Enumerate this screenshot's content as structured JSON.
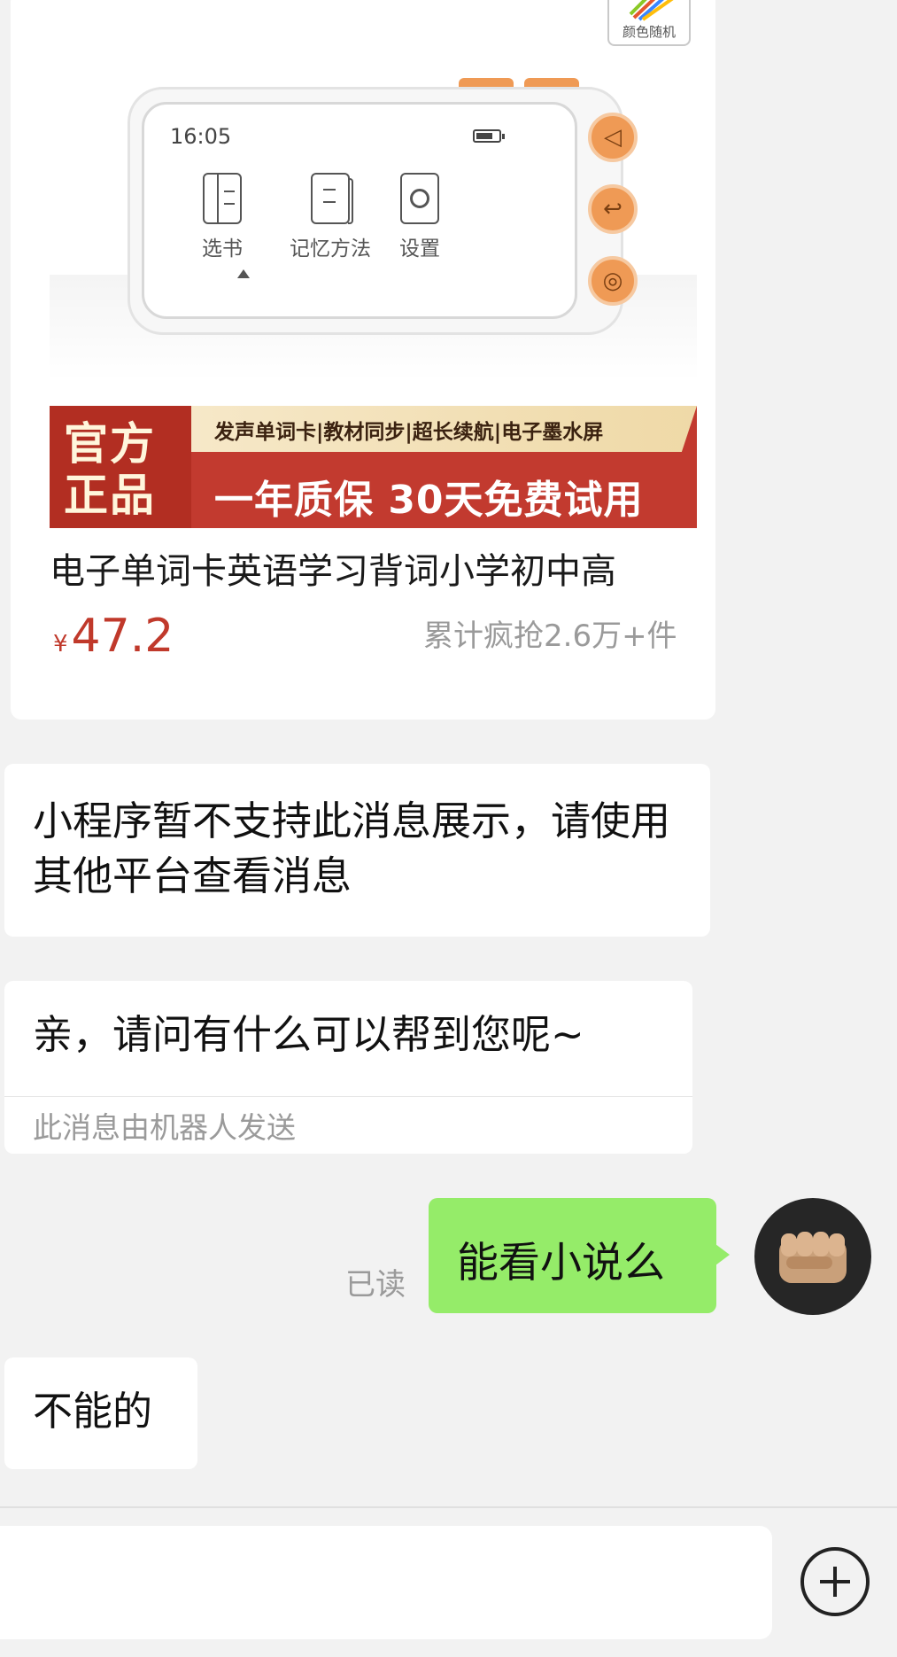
{
  "product": {
    "color_tag": "颜色随机",
    "device_screen": {
      "time": "16:05",
      "items": [
        {
          "label": "选书",
          "icon": "book-icon"
        },
        {
          "label": "记忆方法",
          "icon": "notebook-icon"
        },
        {
          "label": "设置",
          "icon": "settings-icon"
        }
      ],
      "buttons": [
        "speaker-icon",
        "back-icon",
        "power-icon"
      ]
    },
    "banner": {
      "badge": "官方正品",
      "features": "发声单词卡|教材同步|超长续航|电子墨水屏",
      "slogan": "一年质保 30天免费试用"
    },
    "title": "电子单词卡英语学习背词小学初中高",
    "price_symbol": "¥",
    "price": "47.2",
    "sold": "累计疯抢2.6万+件"
  },
  "messages": {
    "unsupported": "小程序暂不支持此消息展示，请使用其他平台查看消息",
    "greeting": "亲，请问有什么可以帮到您呢~",
    "robot_note": "此消息由机器人发送",
    "read_status": "已读",
    "my_message": "能看小说么",
    "reply": "不能的"
  },
  "input": {
    "value": "",
    "plus_icon": "plus-circle-icon"
  },
  "colors": {
    "price": "#c0392b",
    "my_bubble": "#95ec69",
    "banner_red": "#c23a2f",
    "device_button": "#ef9a55"
  }
}
